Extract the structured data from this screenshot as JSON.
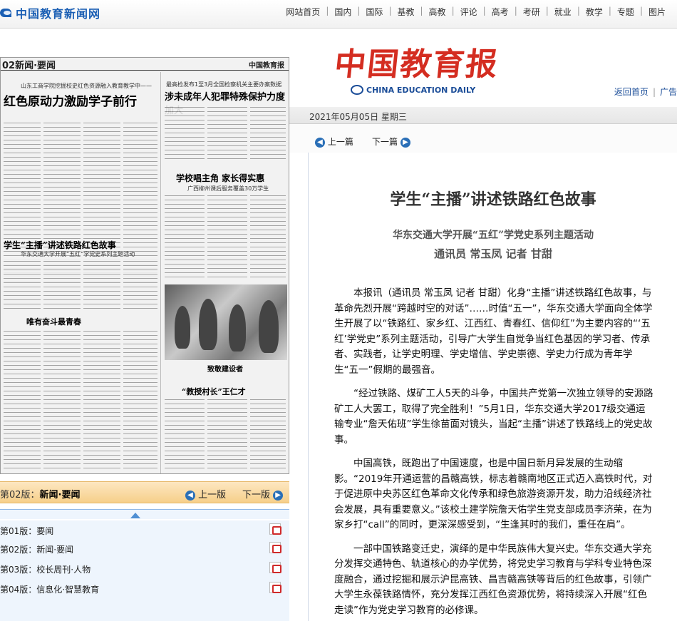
{
  "site": {
    "name": "中国教育新闻网"
  },
  "nav": [
    "网站首页",
    "国内",
    "国际",
    "基教",
    "高教",
    "评论",
    "高考",
    "考研",
    "就业",
    "教学",
    "专题",
    "图片"
  ],
  "paper": {
    "page_label": "02新闻·要闻",
    "brand": "中国教育报",
    "headlines": {
      "h1_kicker": "山东工商学院挖掘校史红色资源融入教育教学中——",
      "h1": "红色原动力激励学子前行",
      "h2_kicker": "最高检发布1至3月全国检察机关主要办案数据",
      "h2": "涉未成年人犯罪特殊保护力度加大",
      "h3": "学校唱主角 家长得实惠",
      "h3_sub": "广西柳州课后服务覆盖30万学生",
      "h4": "学生“主播”讲述铁路红色故事",
      "h4_sub": "华东交通大学开展“五红”学党史系列主题活动",
      "h5": "唯有奋斗最青春",
      "h6": "致敬建设者",
      "h7": "“教授村长”王仁才"
    }
  },
  "page_bar": {
    "current_prefix": "第02版：",
    "current_name": "新闻·要闻",
    "prev": "上一版",
    "next": "下一版"
  },
  "page_list": [
    {
      "label": "第01版：要闻"
    },
    {
      "label": "第02版：新闻·要闻"
    },
    {
      "label": "第03版：校长周刊·人物"
    },
    {
      "label": "第04版：信息化·智慧教育"
    }
  ],
  "masthead": {
    "title_cn": "中国教育报",
    "title_en": "CHINA EDUCATION DAILY",
    "home_link": "返回首页",
    "ad_link": "广告"
  },
  "date": "2021年05月05日 星期三",
  "pager": {
    "prev": "上一篇",
    "next": "下一篇"
  },
  "article": {
    "title": "学生“主播”讲述铁路红色故事",
    "subtitle": "华东交通大学开展“五红”学党史系列主题活动",
    "byline": "通讯员  常玉凤  记者  甘甜",
    "paragraphs": [
      "本报讯（通讯员  常玉凤  记者  甘甜）化身“主播”讲述铁路红色故事，与革命先烈开展“跨越时空的对话”……时值“五一”，华东交通大学面向全体学生开展了以“铁路红、家乡红、江西红、青春红、信仰红”为主要内容的“‘五红’学党史”系列主题活动，引导广大学生自觉争当红色基因的学习者、传承者、实践者，让学史明理、学史增信、学史崇德、学史力行成为青年学生“五一”假期的最强音。",
      "“经过铁路、煤矿工人5天的斗争，中国共产党第一次独立领导的安源路矿工人大罢工，取得了完全胜利！”5月1日，华东交通大学2017级交通运输专业“詹天佑班”学生徐苗面对镜头，当起“主播”讲述了铁路线上的党史故事。",
      "中国高铁，既跑出了中国速度，也是中国日新月异发展的生动缩影。“2019年开通运营的昌赣高铁，标志着赣南地区正式迈入高铁时代，对于促进原中央苏区红色革命文化传承和绿色旅游资源开发，助力沿线经济社会发展，具有重要意义。”该校土建学院詹天佑学生党支部成员李济荣，在为家乡打“call”的同时，更深深感受到，“生逢其时的我们，重任在肩”。",
      "一部中国铁路变迁史，演绎的是中华民族伟大复兴史。华东交通大学充分发挥交通特色、轨道核心的办学优势，将党史学习教育与学科专业特色深度融合，通过挖掘和展示沪昆高铁、昌吉赣高铁等背后的红色故事，引领广大学生永葆铁路情怀，充分发挥江西红色资源优势，将持续深入开展“红色走读”作为党史学习教育的必修课。"
    ]
  }
}
